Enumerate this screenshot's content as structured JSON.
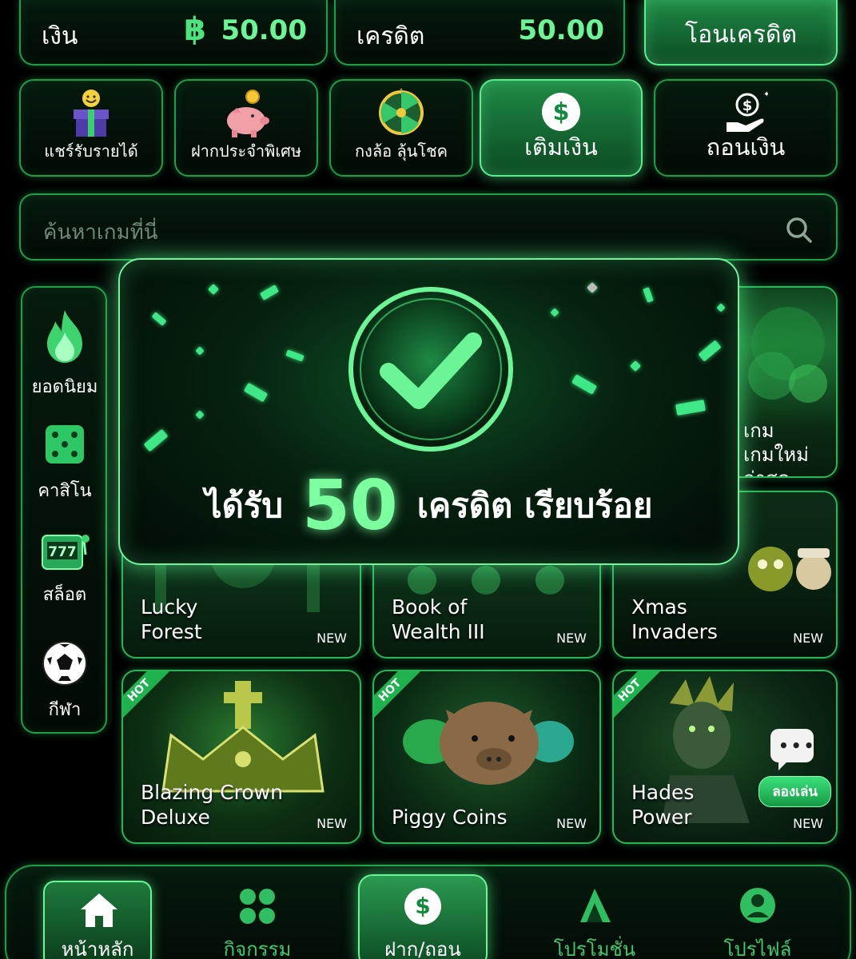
{
  "balance": {
    "money_label": "เงิน",
    "currency_symbol": "฿",
    "money_value": "50.00",
    "credit_label": "เครดิต",
    "credit_value": "50.00",
    "transfer_label": "โอนเครดิต"
  },
  "quick_actions": [
    {
      "label": "แชร์รับรายได้",
      "icon": "gift-icon"
    },
    {
      "label": "ฝากประจำพิเศษ",
      "icon": "piggy-bank-icon"
    },
    {
      "label": "กงล้อ ลุ้นโชค",
      "icon": "wheel-icon"
    },
    {
      "label": "เติมเงิน",
      "icon": "dollar-icon"
    },
    {
      "label": "ถอนเงิน",
      "icon": "withdraw-icon"
    }
  ],
  "search": {
    "placeholder": "ค้นหาเกมที่นี่"
  },
  "categories": [
    {
      "label": "ยอดนิยม",
      "icon": "fire-icon"
    },
    {
      "label": "คาสิโน",
      "icon": "dice-icon"
    },
    {
      "label": "สล็อต",
      "icon": "slot-icon"
    },
    {
      "label": "กีฬา",
      "icon": "soccer-icon"
    }
  ],
  "featured_card": {
    "line1": "เกม",
    "line2": "เกมใหม่ล่าสุด"
  },
  "games_row1": [
    {
      "title_line1": "Lucky",
      "title_line2": "Forest",
      "badge": "NEW"
    },
    {
      "title_line1": "Book of",
      "title_line2": "Wealth III",
      "badge": "NEW"
    },
    {
      "title_line1": "Xmas",
      "title_line2": "Invaders",
      "badge": "NEW"
    }
  ],
  "games_row2": [
    {
      "title_line1": "Blazing Crown",
      "title_line2": "Deluxe",
      "badge": "NEW",
      "tag": "HOT"
    },
    {
      "title_line1": "",
      "title_line2": "Piggy Coins",
      "badge": "NEW",
      "tag": "HOT"
    },
    {
      "title_line1": "Hades",
      "title_line2": "Power",
      "badge": "NEW",
      "tag": "HOT",
      "try_label": "ลองเล่น"
    }
  ],
  "bottom_nav": [
    {
      "label": "หน้าหลัก",
      "icon": "home-icon"
    },
    {
      "label": "กิจกรรม",
      "icon": "activity-icon"
    },
    {
      "label": "ฝาก/ถอน",
      "icon": "deposit-icon"
    },
    {
      "label": "โปรโมชั่น",
      "icon": "promotion-icon"
    },
    {
      "label": "โปรไฟล์",
      "icon": "profile-icon"
    }
  ],
  "modal": {
    "prefix": "ได้รับ",
    "amount": "50",
    "suffix": "เครดิต เรียบร้อย"
  },
  "colors": {
    "accent": "#2fd46a",
    "bright": "#7cff9f",
    "background": "#000000"
  }
}
